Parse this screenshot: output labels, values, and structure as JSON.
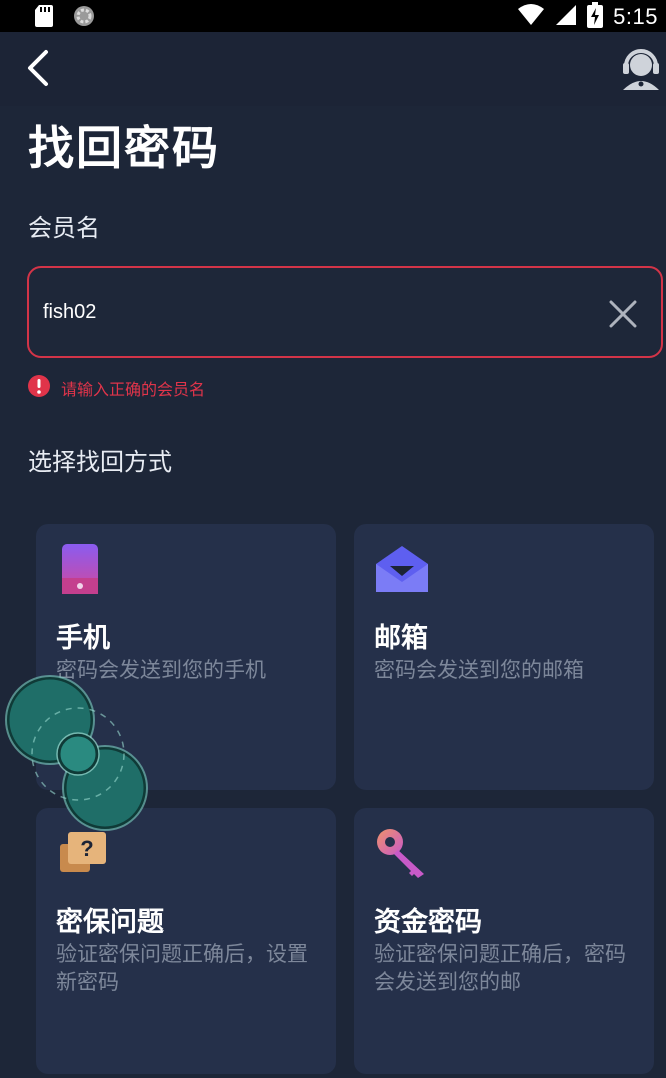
{
  "status_bar": {
    "time": "5:15"
  },
  "page": {
    "title": "找回密码"
  },
  "username": {
    "label": "会员名",
    "value": "fish02",
    "error": "请输入正确的会员名"
  },
  "recovery": {
    "label": "选择找回方式",
    "options": [
      {
        "title": "手机",
        "desc": "密码会发送到您的手机"
      },
      {
        "title": "邮箱",
        "desc": "密码会发送到您的邮箱"
      },
      {
        "title": "密保问题",
        "desc": "验证密保问题正确后，设置新密码"
      },
      {
        "title": "资金密码",
        "desc": "验证密保问题正确后，密码会发送到您的邮"
      }
    ]
  },
  "colors": {
    "background": "#1d2638",
    "card": "#25304a",
    "error": "#d33448",
    "muted_text": "#7d879a"
  },
  "icons": [
    "sd-card-icon",
    "loading-icon",
    "wifi-icon",
    "signal-icon",
    "battery-icon",
    "back-arrow-icon",
    "customer-service-icon",
    "clear-icon",
    "error-icon",
    "phone-icon",
    "email-icon",
    "security-question-icon",
    "key-icon"
  ]
}
